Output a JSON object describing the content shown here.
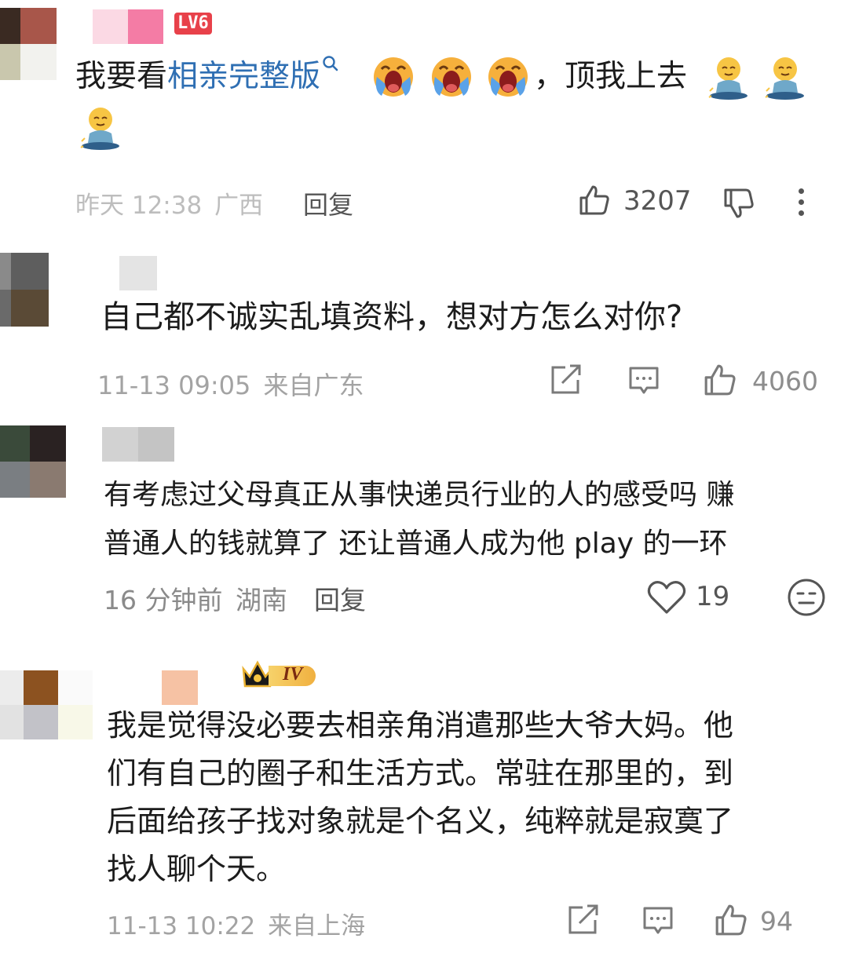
{
  "comments": [
    {
      "level_badge": "LV6",
      "text_before": "我要看",
      "link_text": "相亲完整版",
      "text_after": "，顶我上去",
      "time": "昨天 12:38",
      "location": "广西",
      "reply_label": "回复",
      "likes": "3207"
    },
    {
      "text": "自己都不诚实乱填资料，想对方怎么对你?",
      "time": "11-13 09:05",
      "location": "来自广东",
      "likes": "4060"
    },
    {
      "lines": [
        "有考虑过父母真正从事快递员行业的人的感受吗 赚",
        "普通人的钱就算了 还让普通人成为他 play 的一环"
      ],
      "time": "16 分钟前",
      "location": "湖南",
      "reply_label": "回复",
      "likes": "19"
    },
    {
      "level_badge": "IV",
      "lines": [
        "我是觉得没必要去相亲角消遣那些大爷大妈。他",
        "们有自己的圈子和生活方式。常驻在那里的，到",
        "后面给孩子找对象就是个名义，纯粹就是寂寞了",
        "找人聊个天。"
      ],
      "time": "11-13 10:22",
      "location": "来自上海",
      "likes": "94"
    }
  ],
  "colors": {
    "link": "#2f6fb3",
    "badge_red": "#e8414a",
    "meta_gray": "#a3a3a3",
    "icon_gray": "#6b6b6b"
  }
}
